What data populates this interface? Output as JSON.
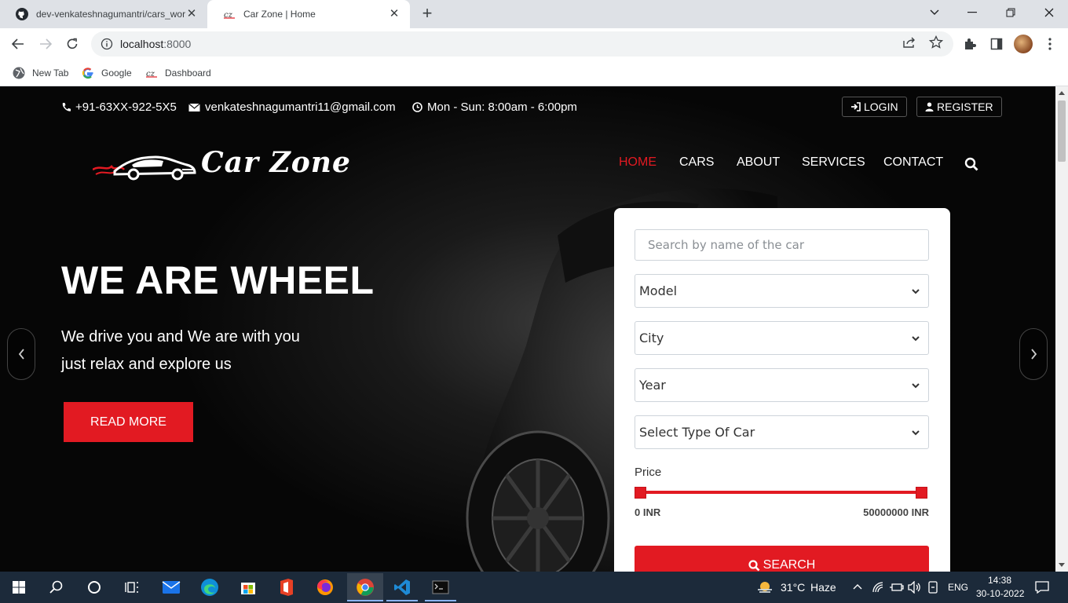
{
  "browser": {
    "tabs": [
      {
        "title": "dev-venkateshnagumantri/cars_wor",
        "active": false
      },
      {
        "title": "Car Zone | Home",
        "active": true
      }
    ],
    "url_host": "localhost",
    "url_port": ":8000",
    "bookmarks": [
      {
        "label": "New Tab",
        "icon": "globe-icon"
      },
      {
        "label": "Google",
        "icon": "google-icon"
      },
      {
        "label": "Dashboard",
        "icon": "carzone-icon"
      }
    ]
  },
  "topbar": {
    "phone": "+91-63XX-922-5X5",
    "email": "venkateshnagumantri11@gmail.com",
    "hours": "Mon - Sun: 8:00am - 6:00pm",
    "login_label": "LOGIN",
    "register_label": "REGISTER"
  },
  "brand": {
    "logo_text": "Car Zone"
  },
  "nav": {
    "items": [
      "HOME",
      "CARS",
      "ABOUT",
      "SERVICES",
      "CONTACT"
    ],
    "active": "HOME"
  },
  "hero": {
    "title": "WE ARE WHEEL",
    "line1": "We drive you and We are with you",
    "line2": "just relax and explore us",
    "cta": "READ MORE"
  },
  "search_form": {
    "placeholder": "Search by name of the car",
    "model": "Model",
    "city": "City",
    "year": "Year",
    "type": "Select Type Of Car",
    "price_label": "Price",
    "price_min": "0 INR",
    "price_max": "50000000 INR",
    "button": "SEARCH"
  },
  "taskbar": {
    "weather_temp": "31°C",
    "weather_desc": "Haze",
    "lang": "ENG",
    "time": "14:38",
    "date": "30-10-2022"
  },
  "colors": {
    "accent": "#e21a22",
    "taskbar": "#1c2a3a"
  }
}
